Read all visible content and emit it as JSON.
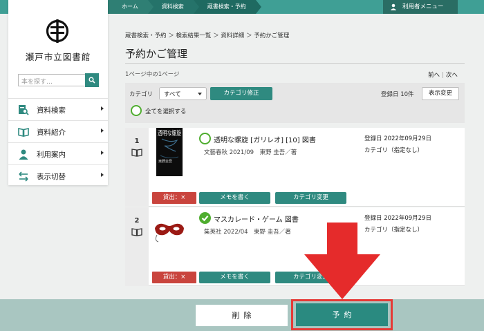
{
  "colors": {
    "teal": "#2f8a80",
    "red_arrow": "#e52b2b",
    "loan_red": "#c9443d",
    "check_green": "#4fad2f"
  },
  "top_nav": {
    "breadcrumbs": [
      "ホーム",
      "資料検索",
      "蔵書検索・予約"
    ],
    "user_menu": "利用者メニュー"
  },
  "sidebar": {
    "library_name": "瀬戸市立図書館",
    "search_placeholder": "本を探す…",
    "items": [
      {
        "label": "資料検索",
        "icon": "search-doc-icon"
      },
      {
        "label": "資料紹介",
        "icon": "open-book-icon"
      },
      {
        "label": "利用案内",
        "icon": "person-icon"
      },
      {
        "label": "表示切替",
        "icon": "switch-arrows-icon"
      }
    ]
  },
  "main": {
    "path": "蔵書検索・予約 ＞ 検索結果一覧 ＞ 資料詳細 ＞ 予約かご管理",
    "title": "予約かご管理",
    "page_info": "1ページ中の1ページ",
    "prev": "前へ",
    "next": "次へ",
    "toolbar": {
      "category_label": "カテゴリ",
      "category_value": "すべて",
      "category_fix_button": "カテゴリ修正",
      "registered_label": "登録日 10件",
      "display_change_button": "表示変更",
      "select_all_label": "全てを選択する"
    },
    "items": [
      {
        "num": "1",
        "title": "透明な螺旋 [ガリレオ] [10] 図書",
        "sub": "文藝春秋 2021/09　東野 圭吾／著",
        "registered": "登録日 2022年09月29日",
        "category": "カテゴリ（指定なし）",
        "loan": "貸出：×",
        "memo": "メモを書く",
        "category_change": "カテゴリ変更",
        "checked": false,
        "cover_text": "透明な螺旋",
        "cover_author": "東野圭吾"
      },
      {
        "num": "2",
        "title": "マスカレード・ゲーム 図書",
        "sub": "集英社 2022/04　東野 圭吾／著",
        "registered": "登録日 2022年09月29日",
        "category": "カテゴリ（指定なし）",
        "loan": "貸出：×",
        "memo": "メモを書く",
        "category_change": "カテゴリ変更",
        "checked": true
      }
    ]
  },
  "footer": {
    "delete_button": "削除",
    "reserve_button": "予約"
  }
}
